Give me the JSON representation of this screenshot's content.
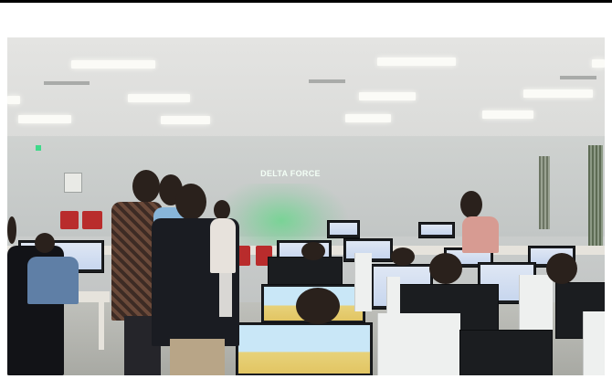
{
  "photo": {
    "description_label": "classroom-computer-lab",
    "projection_text": "DELTA FORCE",
    "colors": {
      "projection_glow": "#3cdc6e",
      "chairs": "#b92c2c",
      "ceiling": "#e4e4e2",
      "monitor": "#1b1d20"
    }
  }
}
